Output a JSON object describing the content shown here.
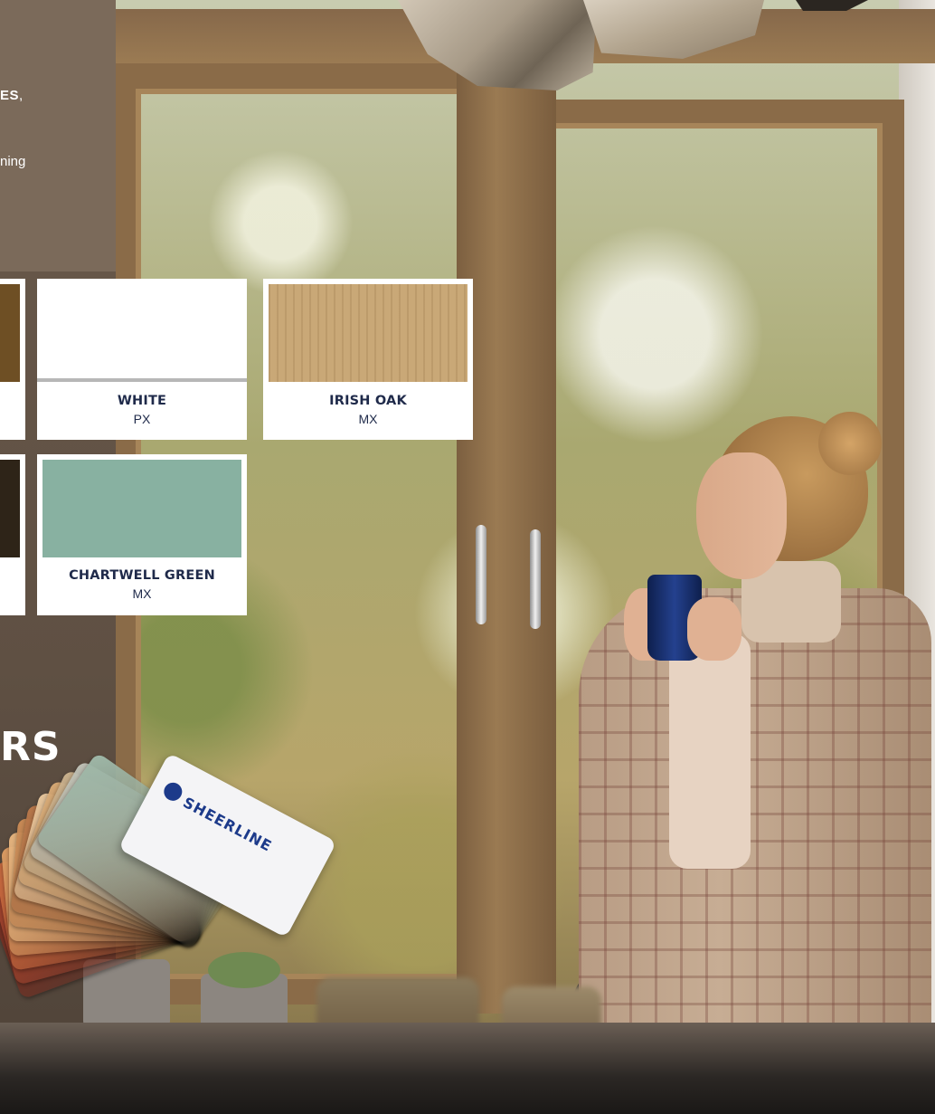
{
  "panel": {
    "line1_bold": "ES",
    "line1_rest": ",",
    "line2": "ning",
    "heading": "RS"
  },
  "swatches": [
    {
      "name": "WHITE",
      "code": "PX",
      "color": "#ffffff"
    },
    {
      "name": "IRISH OAK",
      "code": "MX",
      "color": "#c9a877"
    },
    {
      "name": "CHARTWELL GREEN",
      "code": "MX",
      "color": "#88b1a1"
    }
  ],
  "partial_swatches": [
    {
      "color": "#6e4f24"
    },
    {
      "color": "#2e2418"
    }
  ],
  "fan_deck": {
    "brand": "SHEERLINE"
  }
}
